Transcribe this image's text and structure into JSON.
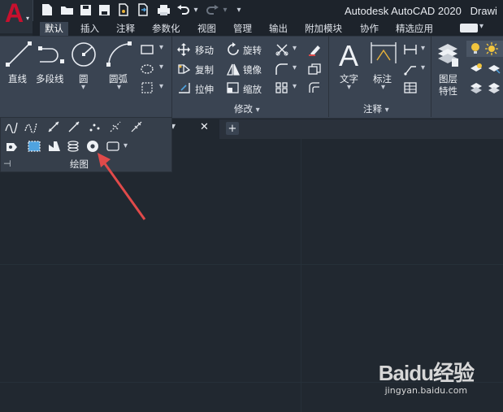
{
  "app": {
    "title": "Autodesk AutoCAD 2020",
    "title_suffix": "Drawi",
    "logo_letter": "A"
  },
  "tabs": [
    "默认",
    "插入",
    "注释",
    "参数化",
    "视图",
    "管理",
    "输出",
    "附加模块",
    "协作",
    "精选应用"
  ],
  "active_tab": 0,
  "ribbon": {
    "draw_tools": [
      {
        "label": "直线",
        "icon": "line-icon"
      },
      {
        "label": "多段线",
        "icon": "polyline-icon"
      },
      {
        "label": "圆",
        "icon": "circle-icon"
      },
      {
        "label": "圆弧",
        "icon": "arc-icon"
      }
    ],
    "modify_tools": [
      {
        "label": "移动",
        "icon": "move-icon"
      },
      {
        "label": "旋转",
        "icon": "rotate-icon"
      },
      {
        "label": "复制",
        "icon": "copy-icon"
      },
      {
        "label": "镜像",
        "icon": "mirror-icon"
      },
      {
        "label": "拉伸",
        "icon": "stretch-icon"
      },
      {
        "label": "缩放",
        "icon": "scale-icon"
      }
    ],
    "modify_panel_title": "修改",
    "annotation": {
      "text_label": "文字",
      "dim_label": "标注",
      "panel_title": "注释"
    },
    "layers": {
      "label_line1": "图层",
      "label_line2": "特性"
    }
  },
  "draw_panel": {
    "title": "绘图",
    "highlighted_tool": "donut-icon"
  },
  "watermark": {
    "brand": "Baidu经验",
    "url": "jingyan.baidu.com"
  },
  "colors": {
    "accent_red": "#c8102e",
    "ribbon_bg": "#3a4452",
    "canvas_bg": "#212830",
    "arrow": "#e04a4a"
  }
}
